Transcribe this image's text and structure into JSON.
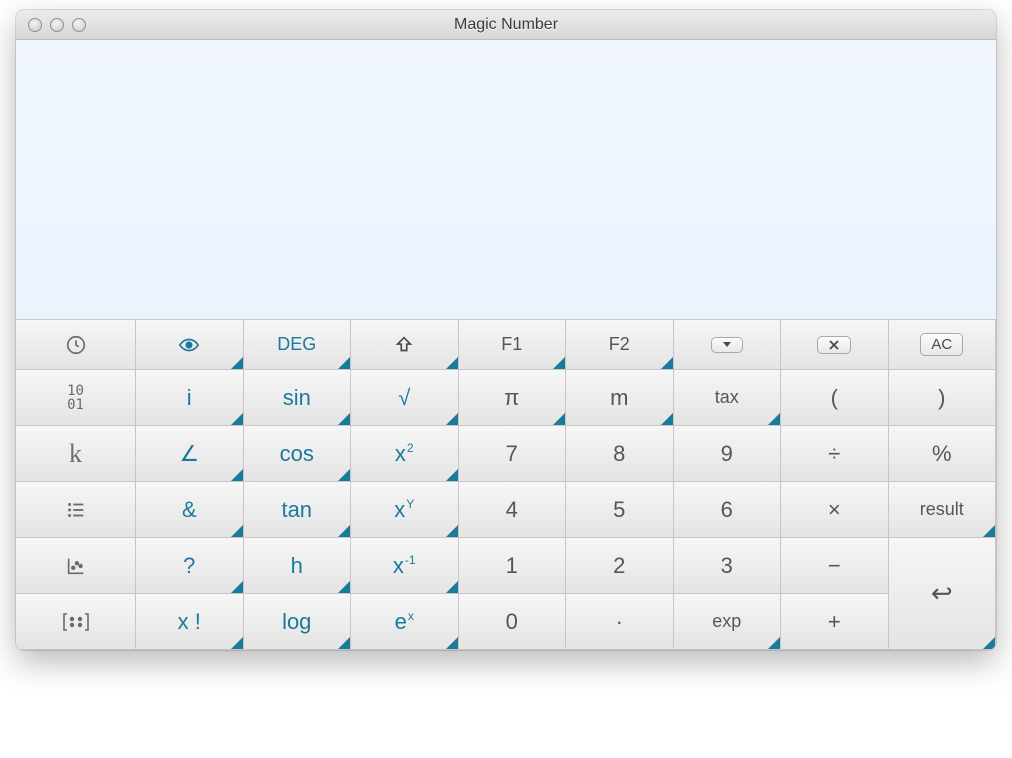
{
  "window": {
    "title": "Magic Number"
  },
  "funcRow": {
    "deg": "DEG",
    "f1": "F1",
    "f2": "F2",
    "ac": "AC"
  },
  "keys": {
    "i": "i",
    "sin": "sin",
    "sqrt": "√",
    "pi": "π",
    "m": "m",
    "tax": "tax",
    "lparen": "(",
    "rparen": ")",
    "angle": "∠",
    "cos": "cos",
    "x2_base": "x",
    "x2_exp": "2",
    "n7": "7",
    "n8": "8",
    "n9": "9",
    "div": "÷",
    "pct": "%",
    "amp": "&",
    "tan": "tan",
    "xy_base": "x",
    "xy_exp": "Y",
    "n4": "4",
    "n5": "5",
    "n6": "6",
    "mul": "×",
    "result": "result",
    "q": "?",
    "h": "h",
    "xinv_base": "x",
    "xinv_exp": "-1",
    "n1": "1",
    "n2": "2",
    "n3": "3",
    "minus": "−",
    "xfact": "x !",
    "log": "log",
    "ex_base": "e",
    "ex_exp": "x",
    "n0": "0",
    "dot": "·",
    "exp": "exp",
    "plus": "+",
    "enter": "↩",
    "k": "k",
    "bits_top": "10",
    "bits_bot": "01"
  }
}
